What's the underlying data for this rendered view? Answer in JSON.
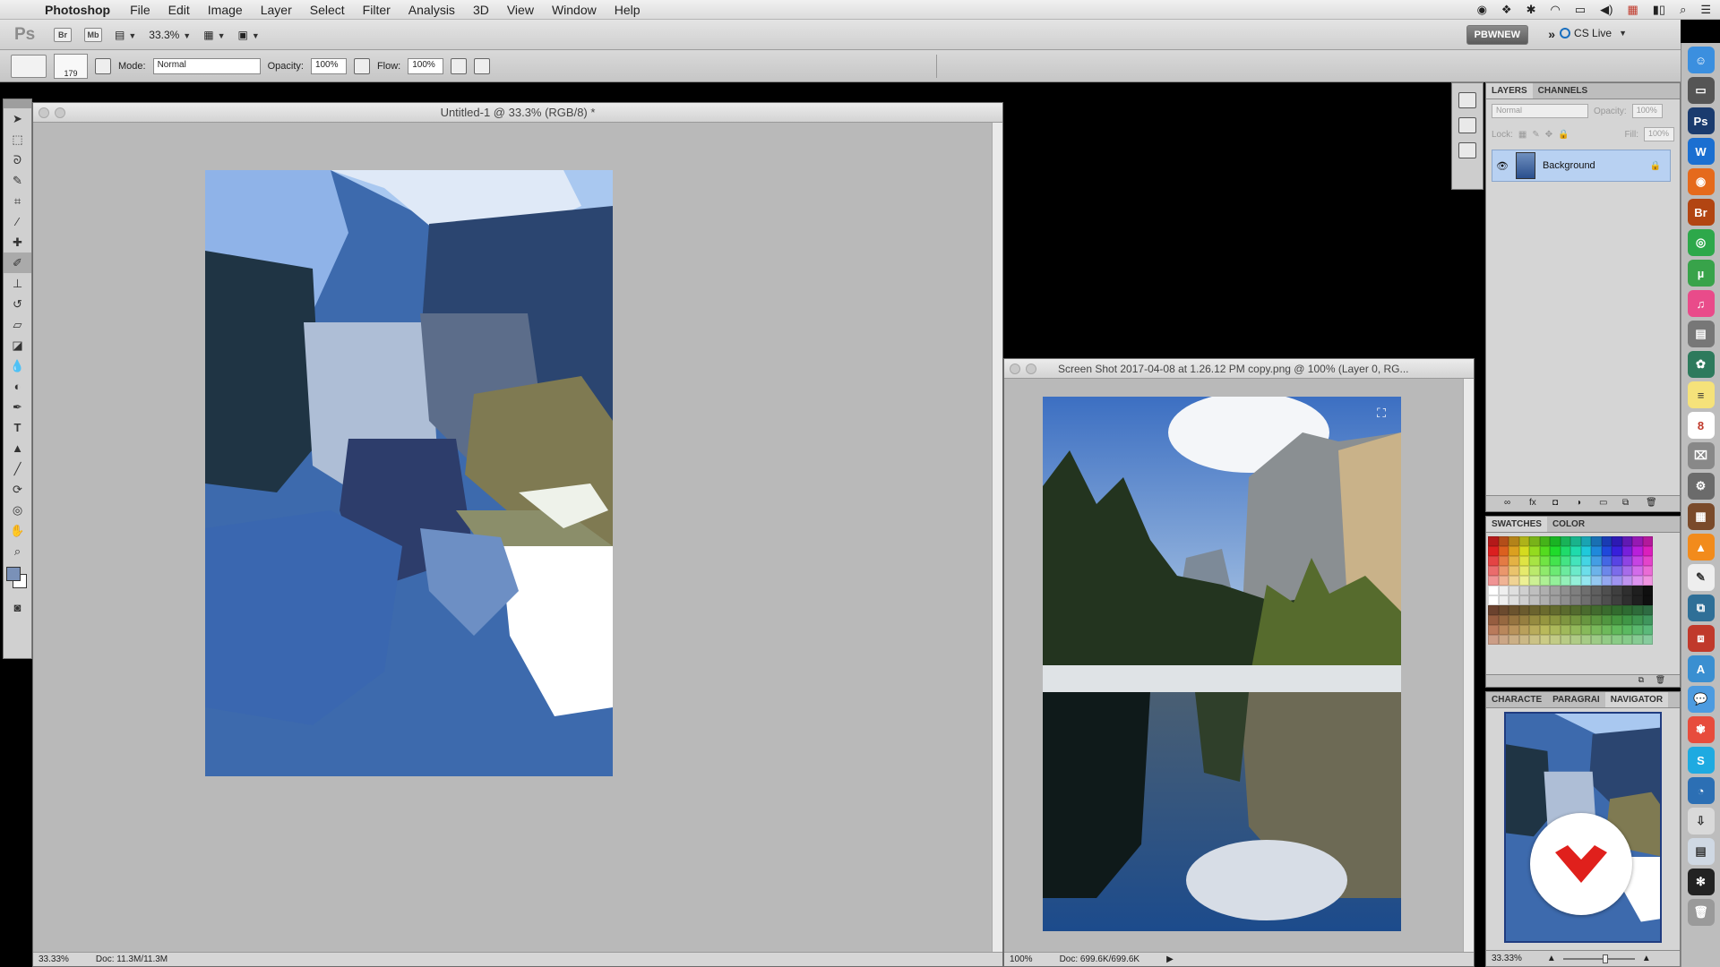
{
  "menubar": {
    "app_name": "Photoshop",
    "items": [
      "File",
      "Edit",
      "Image",
      "Layer",
      "Select",
      "Filter",
      "Analysis",
      "3D",
      "View",
      "Window",
      "Help"
    ]
  },
  "appbar": {
    "logo": "Ps",
    "bridge": "Br",
    "minibridge": "Mb",
    "zoom": "33.3%",
    "workspace": "PBWNEW",
    "cslive": "CS Live"
  },
  "options": {
    "brush_size": "179",
    "mode_label": "Mode:",
    "mode_value": "Normal",
    "opacity_label": "Opacity:",
    "opacity_value": "100%",
    "flow_label": "Flow:",
    "flow_value": "100%"
  },
  "doc1": {
    "title": "Untitled-1 @ 33.3% (RGB/8) *",
    "status_zoom": "33.33%",
    "status_doc": "Doc: 11.3M/11.3M"
  },
  "doc2": {
    "title": "Screen Shot 2017-04-08 at 1.26.12 PM copy.png @ 100% (Layer 0, RG...",
    "status_zoom": "100%",
    "status_doc": "Doc: 699.6K/699.6K"
  },
  "layers_panel": {
    "tab_layers": "LAYERS",
    "tab_channels": "CHANNELS",
    "blend_mode": "Normal",
    "opacity_label": "Opacity:",
    "opacity_value": "100%",
    "lock_label": "Lock:",
    "fill_label": "Fill:",
    "fill_value": "100%",
    "layer_name": "Background"
  },
  "swatches_panel": {
    "tab_swatches": "SWATCHES",
    "tab_color": "COLOR"
  },
  "navigator_panel": {
    "tab_character": "CHARACTE",
    "tab_paragraph": "PARAGRAI",
    "tab_navigator": "NAVIGATOR",
    "zoom": "33.33%"
  },
  "dock_badge": "8",
  "colors": {
    "foreground": "#7a91b8",
    "background": "#ffffff",
    "selection": "#b8d1f2",
    "brand_red": "#e0201c"
  }
}
